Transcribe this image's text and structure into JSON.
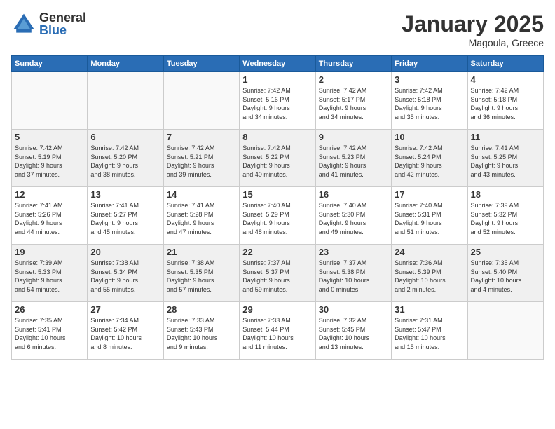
{
  "logo": {
    "general": "General",
    "blue": "Blue"
  },
  "header": {
    "month": "January 2025",
    "location": "Magoula, Greece"
  },
  "weekdays": [
    "Sunday",
    "Monday",
    "Tuesday",
    "Wednesday",
    "Thursday",
    "Friday",
    "Saturday"
  ],
  "weeks": [
    [
      {
        "day": "",
        "info": ""
      },
      {
        "day": "",
        "info": ""
      },
      {
        "day": "",
        "info": ""
      },
      {
        "day": "1",
        "info": "Sunrise: 7:42 AM\nSunset: 5:16 PM\nDaylight: 9 hours\nand 34 minutes."
      },
      {
        "day": "2",
        "info": "Sunrise: 7:42 AM\nSunset: 5:17 PM\nDaylight: 9 hours\nand 34 minutes."
      },
      {
        "day": "3",
        "info": "Sunrise: 7:42 AM\nSunset: 5:18 PM\nDaylight: 9 hours\nand 35 minutes."
      },
      {
        "day": "4",
        "info": "Sunrise: 7:42 AM\nSunset: 5:18 PM\nDaylight: 9 hours\nand 36 minutes."
      }
    ],
    [
      {
        "day": "5",
        "info": "Sunrise: 7:42 AM\nSunset: 5:19 PM\nDaylight: 9 hours\nand 37 minutes."
      },
      {
        "day": "6",
        "info": "Sunrise: 7:42 AM\nSunset: 5:20 PM\nDaylight: 9 hours\nand 38 minutes."
      },
      {
        "day": "7",
        "info": "Sunrise: 7:42 AM\nSunset: 5:21 PM\nDaylight: 9 hours\nand 39 minutes."
      },
      {
        "day": "8",
        "info": "Sunrise: 7:42 AM\nSunset: 5:22 PM\nDaylight: 9 hours\nand 40 minutes."
      },
      {
        "day": "9",
        "info": "Sunrise: 7:42 AM\nSunset: 5:23 PM\nDaylight: 9 hours\nand 41 minutes."
      },
      {
        "day": "10",
        "info": "Sunrise: 7:42 AM\nSunset: 5:24 PM\nDaylight: 9 hours\nand 42 minutes."
      },
      {
        "day": "11",
        "info": "Sunrise: 7:41 AM\nSunset: 5:25 PM\nDaylight: 9 hours\nand 43 minutes."
      }
    ],
    [
      {
        "day": "12",
        "info": "Sunrise: 7:41 AM\nSunset: 5:26 PM\nDaylight: 9 hours\nand 44 minutes."
      },
      {
        "day": "13",
        "info": "Sunrise: 7:41 AM\nSunset: 5:27 PM\nDaylight: 9 hours\nand 45 minutes."
      },
      {
        "day": "14",
        "info": "Sunrise: 7:41 AM\nSunset: 5:28 PM\nDaylight: 9 hours\nand 47 minutes."
      },
      {
        "day": "15",
        "info": "Sunrise: 7:40 AM\nSunset: 5:29 PM\nDaylight: 9 hours\nand 48 minutes."
      },
      {
        "day": "16",
        "info": "Sunrise: 7:40 AM\nSunset: 5:30 PM\nDaylight: 9 hours\nand 49 minutes."
      },
      {
        "day": "17",
        "info": "Sunrise: 7:40 AM\nSunset: 5:31 PM\nDaylight: 9 hours\nand 51 minutes."
      },
      {
        "day": "18",
        "info": "Sunrise: 7:39 AM\nSunset: 5:32 PM\nDaylight: 9 hours\nand 52 minutes."
      }
    ],
    [
      {
        "day": "19",
        "info": "Sunrise: 7:39 AM\nSunset: 5:33 PM\nDaylight: 9 hours\nand 54 minutes."
      },
      {
        "day": "20",
        "info": "Sunrise: 7:38 AM\nSunset: 5:34 PM\nDaylight: 9 hours\nand 55 minutes."
      },
      {
        "day": "21",
        "info": "Sunrise: 7:38 AM\nSunset: 5:35 PM\nDaylight: 9 hours\nand 57 minutes."
      },
      {
        "day": "22",
        "info": "Sunrise: 7:37 AM\nSunset: 5:37 PM\nDaylight: 9 hours\nand 59 minutes."
      },
      {
        "day": "23",
        "info": "Sunrise: 7:37 AM\nSunset: 5:38 PM\nDaylight: 10 hours\nand 0 minutes."
      },
      {
        "day": "24",
        "info": "Sunrise: 7:36 AM\nSunset: 5:39 PM\nDaylight: 10 hours\nand 2 minutes."
      },
      {
        "day": "25",
        "info": "Sunrise: 7:35 AM\nSunset: 5:40 PM\nDaylight: 10 hours\nand 4 minutes."
      }
    ],
    [
      {
        "day": "26",
        "info": "Sunrise: 7:35 AM\nSunset: 5:41 PM\nDaylight: 10 hours\nand 6 minutes."
      },
      {
        "day": "27",
        "info": "Sunrise: 7:34 AM\nSunset: 5:42 PM\nDaylight: 10 hours\nand 8 minutes."
      },
      {
        "day": "28",
        "info": "Sunrise: 7:33 AM\nSunset: 5:43 PM\nDaylight: 10 hours\nand 9 minutes."
      },
      {
        "day": "29",
        "info": "Sunrise: 7:33 AM\nSunset: 5:44 PM\nDaylight: 10 hours\nand 11 minutes."
      },
      {
        "day": "30",
        "info": "Sunrise: 7:32 AM\nSunset: 5:45 PM\nDaylight: 10 hours\nand 13 minutes."
      },
      {
        "day": "31",
        "info": "Sunrise: 7:31 AM\nSunset: 5:47 PM\nDaylight: 10 hours\nand 15 minutes."
      },
      {
        "day": "",
        "info": ""
      }
    ]
  ]
}
